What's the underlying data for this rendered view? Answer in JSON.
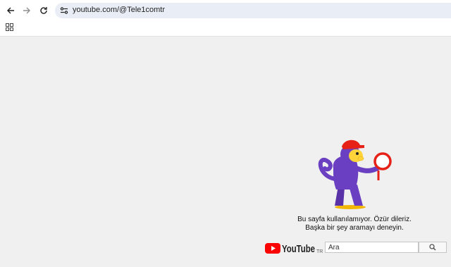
{
  "browser": {
    "url": "youtube.com/@Tele1comtr",
    "icons": [
      "back-arrow-icon",
      "forward-arrow-icon",
      "reload-icon",
      "site-settings-icon",
      "apps-grid-icon"
    ]
  },
  "error": {
    "line1": "Bu sayfa kullanılamıyor. Özür dileriz.",
    "line2": "Başka bir şey aramayı deneyin."
  },
  "logo": {
    "country": "TR"
  },
  "search": {
    "placeholder": "Ara",
    "button_icon": "magnifier-icon"
  },
  "colors": {
    "brand_red": "#ff0000",
    "monkey_purple": "#6a3fc2",
    "monkey_face": "#ffd43b"
  }
}
